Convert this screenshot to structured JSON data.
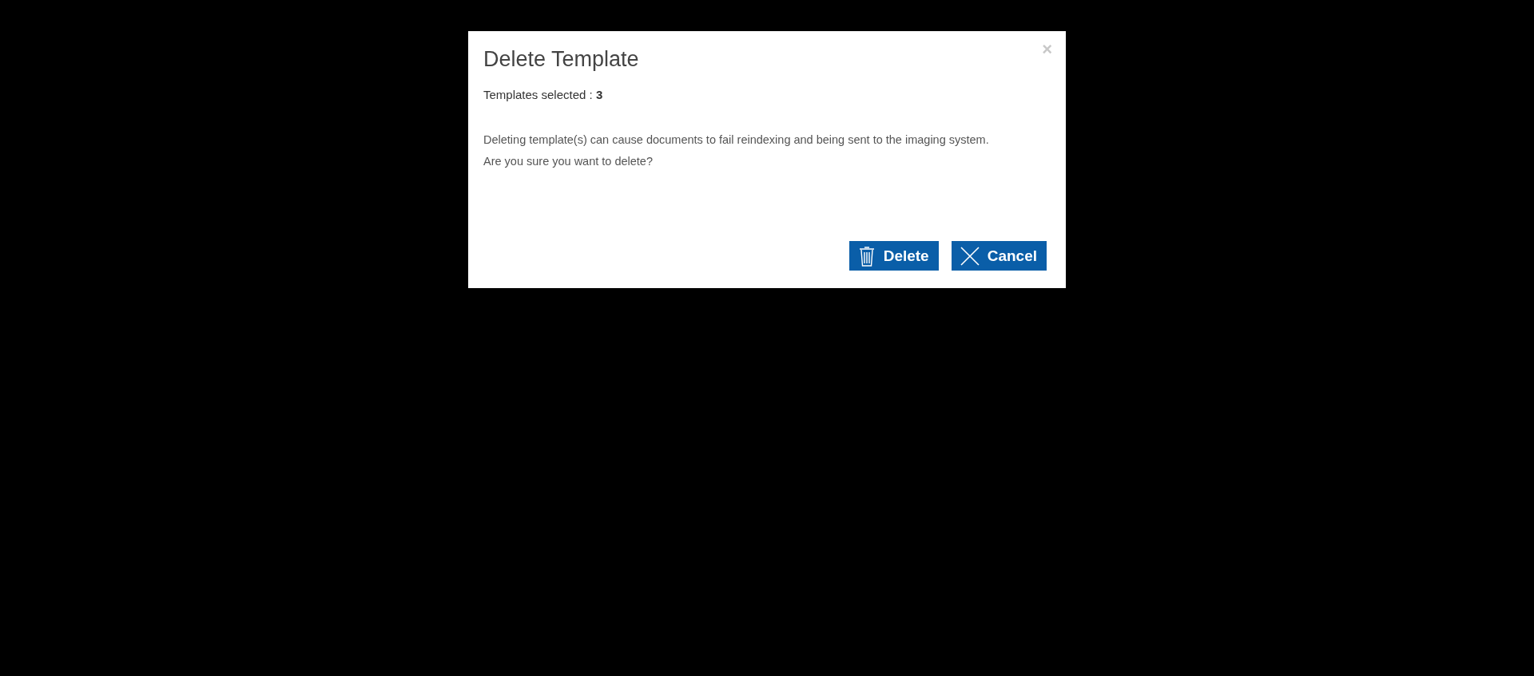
{
  "dialog": {
    "title": "Delete Template",
    "close": "×",
    "summary": {
      "label": "Templates selected : ",
      "value": "3"
    },
    "message": [
      "Deleting template(s) can cause documents to fail reindexing and being sent to the imaging system.",
      "Are you sure you want to delete?"
    ],
    "buttons": [
      {
        "kind": "delete",
        "label": "Delete"
      },
      {
        "kind": "cancel",
        "label": "Cancel"
      }
    ]
  }
}
